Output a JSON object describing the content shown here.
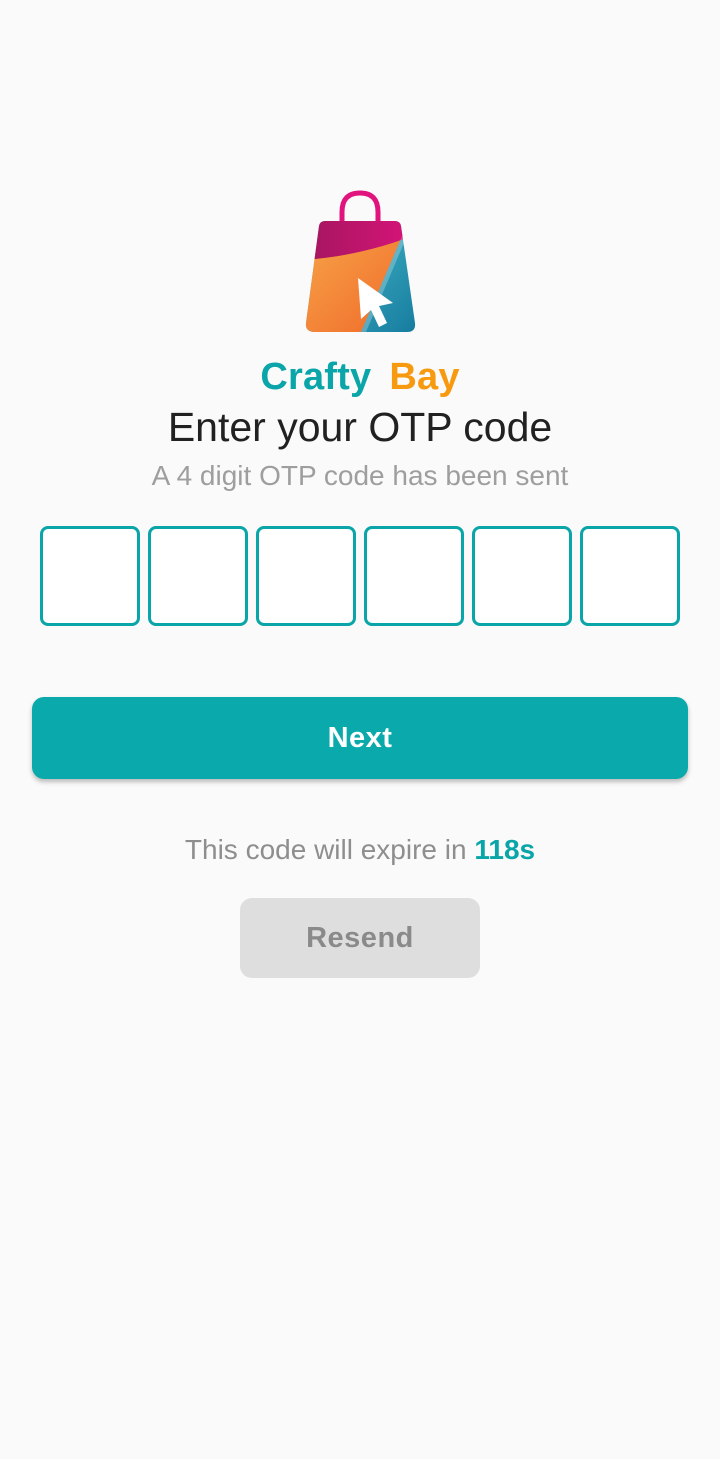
{
  "brand": {
    "word1": "Crafty",
    "word2": "Bay",
    "word1_color": "#0aa5a8",
    "word2_color": "#f79a10",
    "logo_icon": "shopping-bag-cursor-icon"
  },
  "title": "Enter your OTP code",
  "subtitle": "A 4 digit OTP code has been sent",
  "otp": {
    "fields": [
      "",
      "",
      "",
      "",
      "",
      ""
    ],
    "accent_color": "#0aa5a8"
  },
  "next_button": {
    "label": "Next",
    "color": "#0aa9ab"
  },
  "expire": {
    "text": "This code will expire in",
    "seconds": "118s"
  },
  "resend_button": {
    "label": "Resend",
    "color": "#dedede"
  }
}
